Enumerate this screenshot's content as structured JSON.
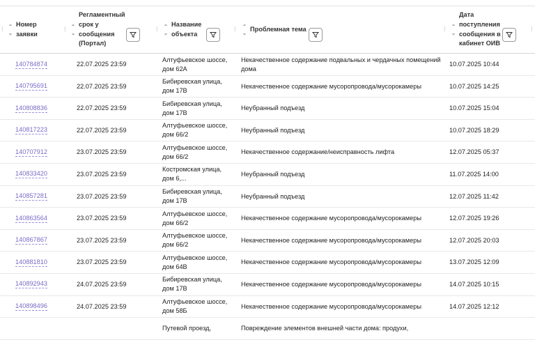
{
  "columns": {
    "number": "Номер заявки",
    "deadline": "Регламентный срок у сообщения (Портал)",
    "object": "Название объекта",
    "topic": "Проблемная тема",
    "received": "Дата поступления сообщения в кабинет ОИВ"
  },
  "icons": {
    "sort": "sort-arrows-icon",
    "filter": "filter-icon",
    "drag": "drag-handle-icon"
  },
  "rows": [
    {
      "id": "140784874",
      "deadline": "22.07.2025 23:59",
      "object": "Алтуфьевское шоссе, дом 62А",
      "topic": "Некачественное содержание подвальных и чердачных помещений дома",
      "received": "10.07.2025 10:44"
    },
    {
      "id": "140795691",
      "deadline": "22.07.2025 23:59",
      "object": "Бибиревская улица, дом 17В",
      "topic": "Некачественное содержание мусоропровода/мусорокамеры",
      "received": "10.07.2025 14:25"
    },
    {
      "id": "140808836",
      "deadline": "22.07.2025 23:59",
      "object": "Бибиревская улица, дом 17В",
      "topic": "Неубранный подъезд",
      "received": "10.07.2025 15:04"
    },
    {
      "id": "140817223",
      "deadline": "22.07.2025 23:59",
      "object": "Алтуфьевское шоссе, дом 66/2",
      "topic": "Неубранный подъезд",
      "received": "10.07.2025 18:29"
    },
    {
      "id": "140707912",
      "deadline": "23.07.2025 23:59",
      "object": "Алтуфьевское шоссе, дом 66/2",
      "topic": "Некачественное содержание/неисправность лифта",
      "received": "12.07.2025 05:37"
    },
    {
      "id": "140833420",
      "deadline": "23.07.2025 23:59",
      "object": "Костромская улица, дом 6,...",
      "topic": "Неубранный подъезд",
      "received": "11.07.2025 14:00"
    },
    {
      "id": "140857281",
      "deadline": "23.07.2025 23:59",
      "object": "Бибиревская улица, дом 17В",
      "topic": "Неубранный подъезд",
      "received": "12.07.2025 11:42"
    },
    {
      "id": "140863564",
      "deadline": "23.07.2025 23:59",
      "object": "Алтуфьевское шоссе, дом 66/2",
      "topic": "Некачественное содержание мусоропровода/мусорокамеры",
      "received": "12.07.2025 19:26"
    },
    {
      "id": "140867867",
      "deadline": "23.07.2025 23:59",
      "object": "Алтуфьевское шоссе, дом 66/2",
      "topic": "Некачественное содержание мусоропровода/мусорокамеры",
      "received": "12.07.2025 20:03"
    },
    {
      "id": "140881810",
      "deadline": "23.07.2025 23:59",
      "object": "Алтуфьевское шоссе, дом 64В",
      "topic": "Некачественное содержание мусоропровода/мусорокамеры",
      "received": "13.07.2025 12:09"
    },
    {
      "id": "140892943",
      "deadline": "24.07.2025 23:59",
      "object": "Бибиревская улица, дом 17В",
      "topic": "Некачественное содержание мусоропровода/мусорокамеры",
      "received": "14.07.2025 10:15"
    },
    {
      "id": "140898496",
      "deadline": "24.07.2025 23:59",
      "object": "Алтуфьевское шоссе, дом 58Б",
      "topic": "Некачественное содержание мусоропровода/мусорокамеры",
      "received": "14.07.2025 12:12"
    },
    {
      "id": "",
      "deadline": "",
      "object": "Путевой проезд,",
      "topic": "Повреждение элементов внешней части дома: продухи,",
      "received": ""
    }
  ]
}
